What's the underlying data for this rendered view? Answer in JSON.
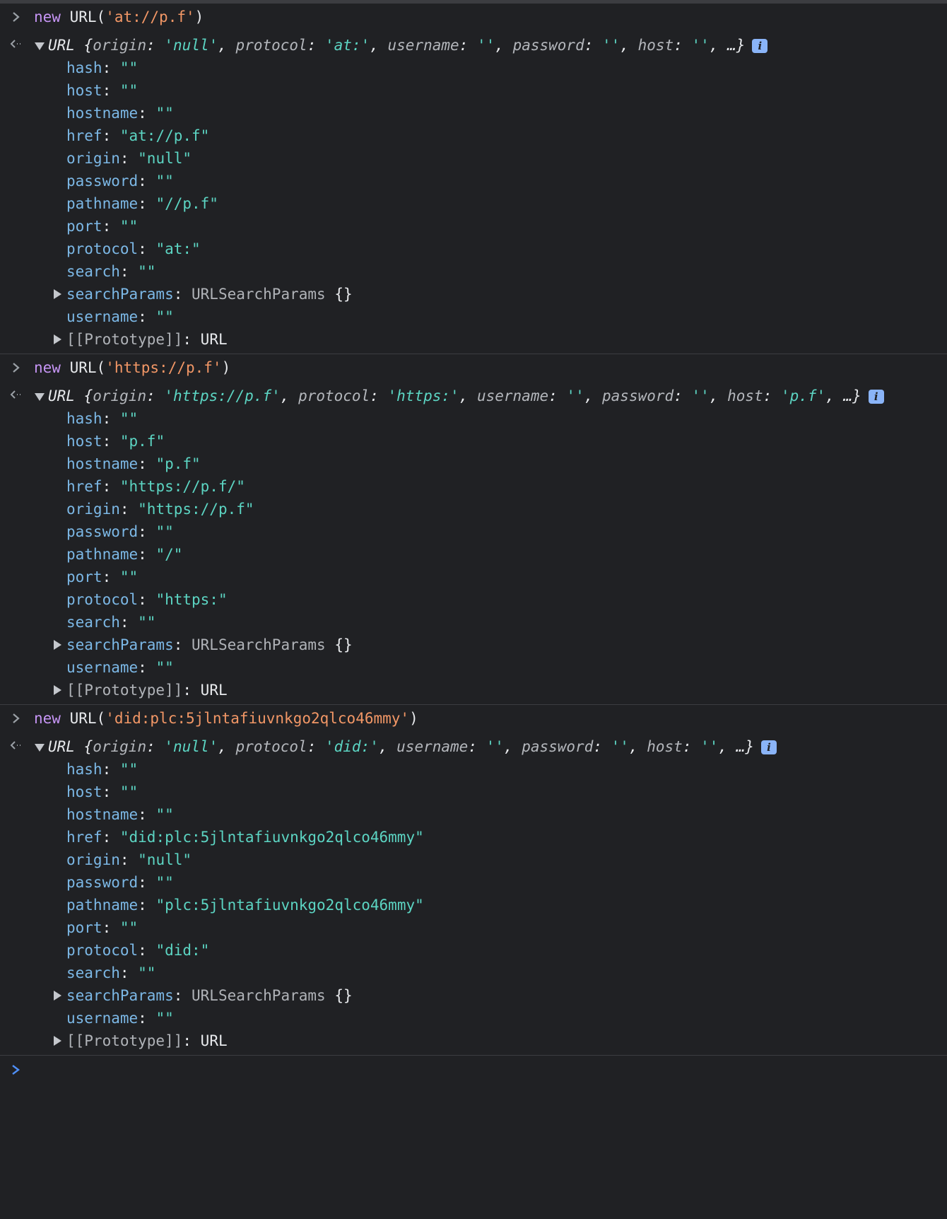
{
  "colors": {
    "background": "#202124",
    "keyword": "#c695f5",
    "string_literal": "#f29766",
    "value": "#5cd5c3",
    "property_key": "#7cb8e6",
    "prompt_active": "#4f8ff7"
  },
  "icons": {
    "prompt": "chevron-right-icon",
    "result": "return-arrow-icon",
    "expanded": "triangle-down-icon",
    "collapsed": "triangle-right-icon",
    "info": "info-icon"
  },
  "entries": [
    {
      "command": {
        "keyword": "new",
        "callee": "URL",
        "open": "(",
        "arg": "'at://p.f'",
        "close": ")"
      },
      "summary": {
        "type": "URL",
        "text_parts": [
          {
            "k": "origin",
            "v": "'null'"
          },
          {
            "k": "protocol",
            "v": "'at:'"
          },
          {
            "k": "username",
            "v": "''"
          },
          {
            "k": "password",
            "v": "''"
          },
          {
            "k": "host",
            "v": "''"
          }
        ],
        "ellipsis": "…}",
        "info_label": "i"
      },
      "props": [
        {
          "name": "hash",
          "value": "\"\""
        },
        {
          "name": "host",
          "value": "\"\""
        },
        {
          "name": "hostname",
          "value": "\"\""
        },
        {
          "name": "href",
          "value": "\"at://p.f\""
        },
        {
          "name": "origin",
          "value": "\"null\""
        },
        {
          "name": "password",
          "value": "\"\""
        },
        {
          "name": "pathname",
          "value": "\"//p.f\""
        },
        {
          "name": "port",
          "value": "\"\""
        },
        {
          "name": "protocol",
          "value": "\"at:\""
        },
        {
          "name": "search",
          "value": "\"\""
        }
      ],
      "search_params": {
        "name": "searchParams",
        "type": "URLSearchParams",
        "value": "{}"
      },
      "username": {
        "name": "username",
        "value": "\"\""
      },
      "prototype": {
        "name": "[[Prototype]]",
        "value": "URL"
      }
    },
    {
      "command": {
        "keyword": "new",
        "callee": "URL",
        "open": "(",
        "arg": "'https://p.f'",
        "close": ")"
      },
      "summary": {
        "type": "URL",
        "text_parts": [
          {
            "k": "origin",
            "v": "'https://p.f'"
          },
          {
            "k": "protocol",
            "v": "'https:'"
          },
          {
            "k": "username",
            "v": "''"
          },
          {
            "k": "password",
            "v": "''"
          },
          {
            "k": "host",
            "v": "'p.f'"
          }
        ],
        "ellipsis": "…}",
        "info_label": "i"
      },
      "props": [
        {
          "name": "hash",
          "value": "\"\""
        },
        {
          "name": "host",
          "value": "\"p.f\""
        },
        {
          "name": "hostname",
          "value": "\"p.f\""
        },
        {
          "name": "href",
          "value": "\"https://p.f/\""
        },
        {
          "name": "origin",
          "value": "\"https://p.f\""
        },
        {
          "name": "password",
          "value": "\"\""
        },
        {
          "name": "pathname",
          "value": "\"/\""
        },
        {
          "name": "port",
          "value": "\"\""
        },
        {
          "name": "protocol",
          "value": "\"https:\""
        },
        {
          "name": "search",
          "value": "\"\""
        }
      ],
      "search_params": {
        "name": "searchParams",
        "type": "URLSearchParams",
        "value": "{}"
      },
      "username": {
        "name": "username",
        "value": "\"\""
      },
      "prototype": {
        "name": "[[Prototype]]",
        "value": "URL"
      }
    },
    {
      "command": {
        "keyword": "new",
        "callee": "URL",
        "open": "(",
        "arg": "'did:plc:5jlntafiuvnkgo2qlco46mmy'",
        "close": ")"
      },
      "summary": {
        "type": "URL",
        "text_parts": [
          {
            "k": "origin",
            "v": "'null'"
          },
          {
            "k": "protocol",
            "v": "'did:'"
          },
          {
            "k": "username",
            "v": "''"
          },
          {
            "k": "password",
            "v": "''"
          },
          {
            "k": "host",
            "v": "''"
          }
        ],
        "ellipsis": "…}",
        "info_label": "i"
      },
      "props": [
        {
          "name": "hash",
          "value": "\"\""
        },
        {
          "name": "host",
          "value": "\"\""
        },
        {
          "name": "hostname",
          "value": "\"\""
        },
        {
          "name": "href",
          "value": "\"did:plc:5jlntafiuvnkgo2qlco46mmy\""
        },
        {
          "name": "origin",
          "value": "\"null\""
        },
        {
          "name": "password",
          "value": "\"\""
        },
        {
          "name": "pathname",
          "value": "\"plc:5jlntafiuvnkgo2qlco46mmy\""
        },
        {
          "name": "port",
          "value": "\"\""
        },
        {
          "name": "protocol",
          "value": "\"did:\""
        },
        {
          "name": "search",
          "value": "\"\""
        }
      ],
      "search_params": {
        "name": "searchParams",
        "type": "URLSearchParams",
        "value": "{}"
      },
      "username": {
        "name": "username",
        "value": "\"\""
      },
      "prototype": {
        "name": "[[Prototype]]",
        "value": "URL"
      }
    }
  ],
  "console_input": {
    "value": ""
  }
}
